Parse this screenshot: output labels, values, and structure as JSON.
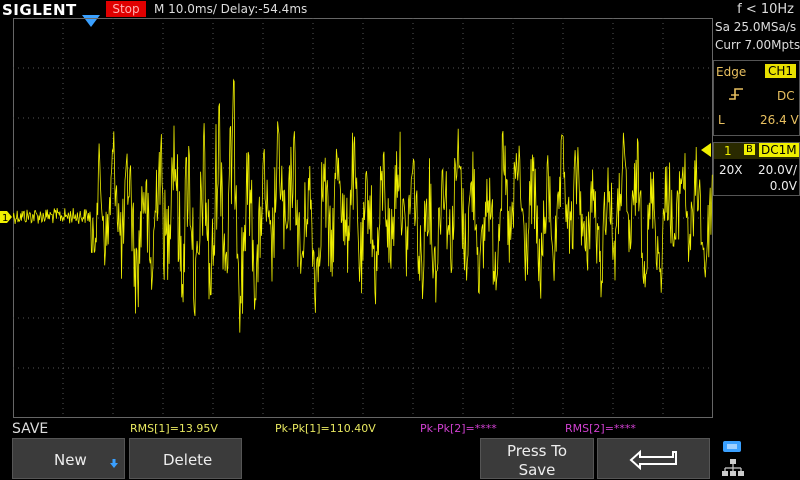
{
  "header": {
    "brand": "SIGLENT",
    "run_state": "Stop",
    "timebase": "M 10.0ms/ Delay:-54.4ms",
    "freq": "f < 10Hz"
  },
  "acquisition": {
    "sample_rate": "Sa 25.0MSa/s",
    "memory": "Curr 7.00Mpts"
  },
  "trigger": {
    "type": "Edge",
    "source": "CH1",
    "coupling": "DC",
    "slope_icon": "rising-edge-icon",
    "level_label": "L",
    "level": "26.4 V"
  },
  "channel1": {
    "number": "1",
    "bw_icon": "B",
    "coupling": "DC1M",
    "probe": "20X",
    "scale": "20.0V/",
    "offset": "0.0V",
    "marker_label": "1"
  },
  "save_label": "SAVE",
  "measurements": [
    {
      "label": "RMS[1]=13.95V",
      "color": "#e8e860"
    },
    {
      "label": "Pk-Pk[1]=110.40V",
      "color": "#e8e860"
    },
    {
      "label": "Pk-Pk[2]=****",
      "color": "#d040d0"
    },
    {
      "label": "RMS[2]=****",
      "color": "#d040d0"
    }
  ],
  "softkeys": {
    "new": "New",
    "delete": "Delete",
    "press_to_save_line1": "Press To",
    "press_to_save_line2": "Save"
  },
  "colors": {
    "ch1": "#f0f000",
    "stop": "#e00000",
    "trigger_marker": "#3aa0ff",
    "ch2": "#d040d0"
  }
}
